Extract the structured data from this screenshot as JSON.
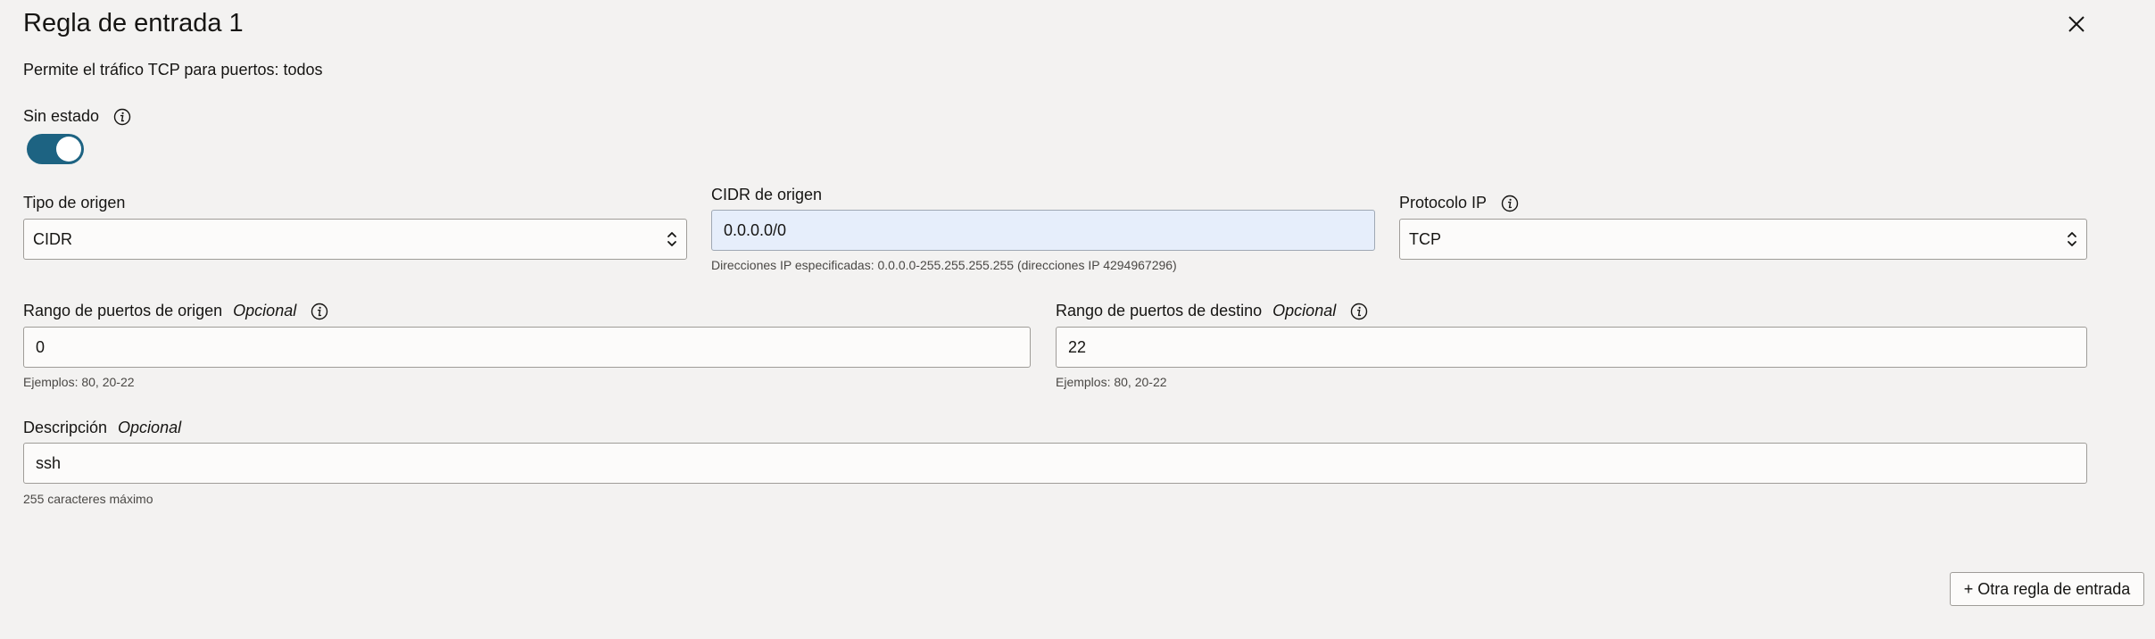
{
  "dialog": {
    "title": "Regla de entrada 1",
    "subtitle": "Permite el tráfico TCP para puertos: todos"
  },
  "stateless": {
    "label": "Sin estado",
    "enabled": true
  },
  "source_type": {
    "label": "Tipo de origen",
    "value": "CIDR"
  },
  "source_cidr": {
    "label": "CIDR de origen",
    "value": "0.0.0.0/0",
    "hint": "Direcciones IP especificadas: 0.0.0.0-255.255.255.255 (direcciones IP 4294967296)"
  },
  "ip_protocol": {
    "label": "Protocolo IP",
    "value": "TCP"
  },
  "source_port_range": {
    "label": "Rango de puertos de origen",
    "optional": "Opcional",
    "value": "0",
    "hint": "Ejemplos: 80, 20-22"
  },
  "dest_port_range": {
    "label": "Rango de puertos de destino",
    "optional": "Opcional",
    "value": "22",
    "hint": "Ejemplos: 80, 20-22"
  },
  "description": {
    "label": "Descripción",
    "optional": "Opcional",
    "value": "ssh",
    "hint": "255 caracteres máximo"
  },
  "add_rule_button": "+ Otra regla de entrada",
  "colors": {
    "background": "#f3f2f1",
    "toggle_on": "#1d6382",
    "focused_field": "#e6eefb"
  },
  "icons": [
    "close-icon",
    "info-icon",
    "chevron-updown-icon"
  ]
}
